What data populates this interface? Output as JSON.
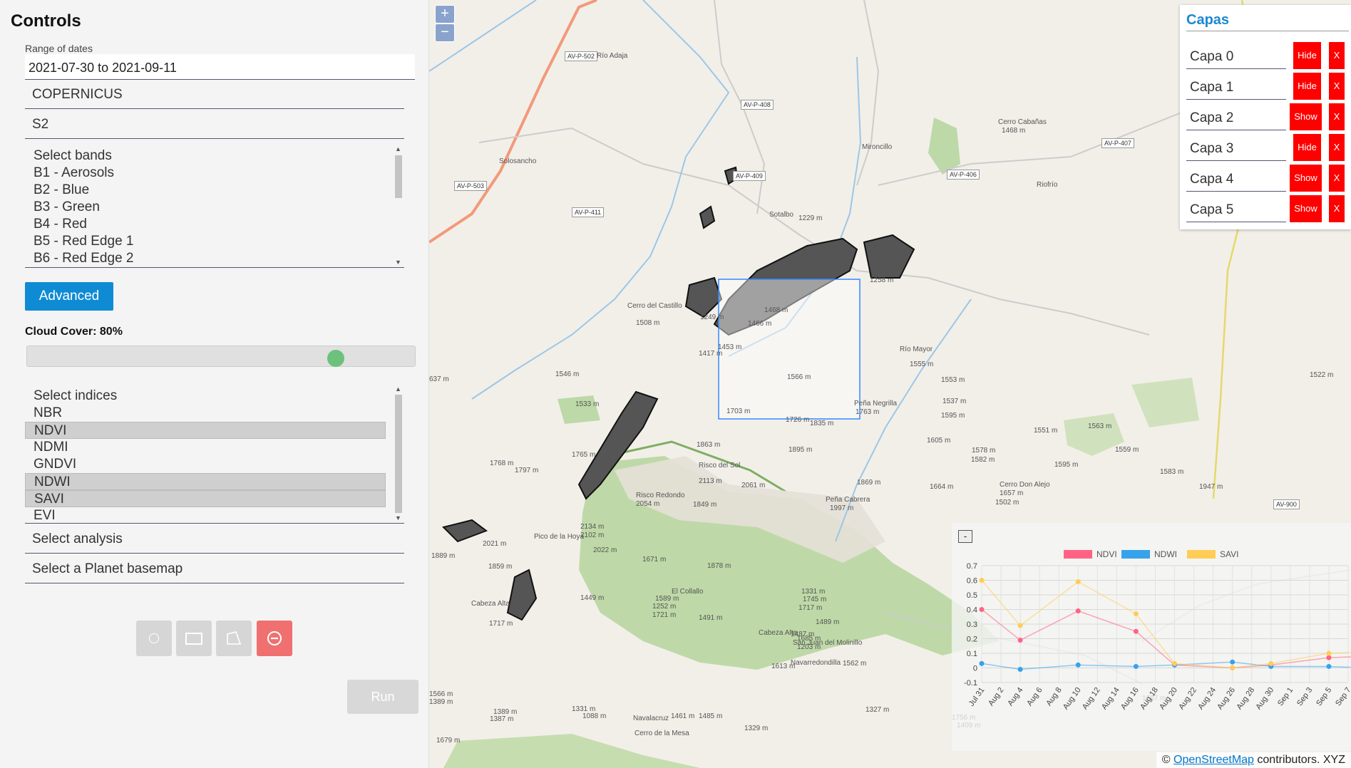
{
  "sidebar": {
    "title": "Controls",
    "date_label": "Range of dates",
    "date_value": "2021-07-30 to 2021-09-11",
    "provider": "COPERNICUS",
    "satellite": "S2",
    "bands": [
      "Select bands",
      "B1 - Aerosols",
      "B2 - Blue",
      "B3 - Green",
      "B4 - Red",
      "B5 - Red Edge 1",
      "B6 - Red Edge 2"
    ],
    "advanced_label": "Advanced",
    "cloud_cover_label": "Cloud Cover: 80%",
    "cloud_cover_value": 0.8,
    "indices": [
      {
        "label": "Select indices",
        "selected": false
      },
      {
        "label": "NBR",
        "selected": false
      },
      {
        "label": "NDVI",
        "selected": true
      },
      {
        "label": "NDMI",
        "selected": false
      },
      {
        "label": "GNDVI",
        "selected": false
      },
      {
        "label": "NDWI",
        "selected": true
      },
      {
        "label": "SAVI",
        "selected": true
      },
      {
        "label": "EVI",
        "selected": false
      }
    ],
    "analysis_placeholder": "Select analysis",
    "basemap_placeholder": "Select a Planet basemap",
    "tools": [
      "circle-tool-icon",
      "rectangle-tool-icon",
      "polygon-tool-icon",
      "delete-tool-icon"
    ],
    "run_label": "Run",
    "colors": {
      "accent": "#0f8bd4",
      "slider": "#6cc27a",
      "delete": "#f07070"
    }
  },
  "map": {
    "zoom_in": "+",
    "zoom_out": "−",
    "labels": [
      "AV-P-502",
      "Río Adaja",
      "AV-P-408",
      "Solosancho",
      "Mironcillo",
      "Cerro Cabañas",
      "1468 m",
      "AV-P-407",
      "AV-P-503",
      "AV-P-409",
      "AV-P-406",
      "Riofrío",
      "AV-P-411",
      "Sotalbo",
      "1229 m",
      "1373 m",
      "1258 m",
      "Cerro del Castillo",
      "1508 m",
      "1249 m",
      "1468 m",
      "1466 m",
      "1417 m",
      "1453 m",
      "Río Mayor",
      "1555 m",
      "1546 m",
      "1566 m",
      "Peña Negrilla",
      "1763 m",
      "1553 m",
      "1522 m",
      "637 m",
      "1533 m",
      "1703 m",
      "1726 m",
      "1835 m",
      "1537 m",
      "1595 m",
      "1551 m",
      "1563 m",
      "1765 m",
      "1863 m",
      "1895 m",
      "1605 m",
      "1578 m",
      "1559 m",
      "1768 m",
      "1797 m",
      "Risco del Sol",
      "2113 m",
      "2061 m",
      "1869 m",
      "1582 m",
      "1595 m",
      "1583 m",
      "Risco Redondo",
      "2054 m",
      "1849 m",
      "Peña Cabrera",
      "1997 m",
      "1664 m",
      "Cerro Don Alejo",
      "1657 m",
      "1502 m",
      "AV-900",
      "1947 m",
      "2021 m",
      "Pico de la Hoya",
      "2134 m",
      "2102 m",
      "2022 m",
      "1671 m",
      "1878 m",
      "1889 m",
      "1859 m",
      "1449 m",
      "El Collallo",
      "1331 m",
      "1745 m",
      "1717 m",
      "Cabeza Alta",
      "1717 m",
      "1589 m",
      "1252 m",
      "1721 m",
      "1491 m",
      "1489 m",
      "Cabeza Alta",
      "1487 m",
      "San Juan del Molinillo",
      "Navarredondilla",
      "1685 m",
      "1203 m",
      "1613 m",
      "1562 m",
      "1657 m",
      "1566 m",
      "1389 m",
      "1389 m",
      "1387 m",
      "1331 m",
      "1088 m",
      "Navalacruz",
      "1461 m",
      "Cerro de la Mesa",
      "1485 m",
      "1329 m",
      "1327 m",
      "1756 m",
      "1409 m",
      "1679 m"
    ],
    "attribution_prefix": "© ",
    "attribution_link": "OpenStreetMap",
    "attribution_suffix": " contributors. XYZ"
  },
  "layers_panel": {
    "title": "Capas",
    "layers": [
      {
        "name": "Capa 0",
        "toggle": "Hide",
        "remove": "X"
      },
      {
        "name": "Capa 1",
        "toggle": "Hide",
        "remove": "X"
      },
      {
        "name": "Capa 2",
        "toggle": "Show",
        "remove": "X"
      },
      {
        "name": "Capa 3",
        "toggle": "Hide",
        "remove": "X"
      },
      {
        "name": "Capa 4",
        "toggle": "Show",
        "remove": "X"
      },
      {
        "name": "Capa 5",
        "toggle": "Show",
        "remove": "X"
      }
    ]
  },
  "chart_panel": {
    "collapse_label": "-",
    "chart_data": {
      "type": "line",
      "x": [
        "Jul 31",
        "Aug 2",
        "Aug 4",
        "Aug 6",
        "Aug 8",
        "Aug 10",
        "Aug 12",
        "Aug 14",
        "Aug 16",
        "Aug 18",
        "Aug 20",
        "Aug 22",
        "Aug 24",
        "Aug 26",
        "Aug 28",
        "Aug 30",
        "Sep 1",
        "Sep 3",
        "Sep 5",
        "Sep 7"
      ],
      "ylim": [
        -0.1,
        0.7
      ],
      "yticks": [
        -0.1,
        0,
        0.1,
        0.2,
        0.3,
        0.4,
        0.5,
        0.6,
        0.7
      ],
      "legend_position": "top",
      "series": [
        {
          "name": "NDVI",
          "color": "#ff6384",
          "points": [
            [
              "Jul 31",
              0.4
            ],
            [
              "Aug 4",
              0.19
            ],
            [
              "Aug 10",
              0.39
            ],
            [
              "Aug 16",
              0.25
            ],
            [
              "Aug 20",
              0.02
            ],
            [
              "Aug 26",
              0.0
            ],
            [
              "Aug 30",
              0.02
            ],
            [
              "Sep 5",
              0.07
            ],
            [
              "Sep 9",
              0.08
            ]
          ]
        },
        {
          "name": "NDWI",
          "color": "#36a2eb",
          "points": [
            [
              "Jul 31",
              0.03
            ],
            [
              "Aug 4",
              -0.01
            ],
            [
              "Aug 10",
              0.02
            ],
            [
              "Aug 16",
              0.01
            ],
            [
              "Aug 20",
              0.02
            ],
            [
              "Aug 26",
              0.04
            ],
            [
              "Aug 30",
              0.01
            ],
            [
              "Sep 5",
              0.01
            ],
            [
              "Sep 9",
              0.0
            ]
          ]
        },
        {
          "name": "SAVI",
          "color": "#ffcd56",
          "points": [
            [
              "Jul 31",
              0.6
            ],
            [
              "Aug 4",
              0.29
            ],
            [
              "Aug 10",
              0.59
            ],
            [
              "Aug 16",
              0.37
            ],
            [
              "Aug 20",
              0.03
            ],
            [
              "Aug 26",
              0.0
            ],
            [
              "Aug 30",
              0.03
            ],
            [
              "Sep 5",
              0.1
            ],
            [
              "Sep 9",
              0.11
            ]
          ]
        }
      ]
    }
  }
}
